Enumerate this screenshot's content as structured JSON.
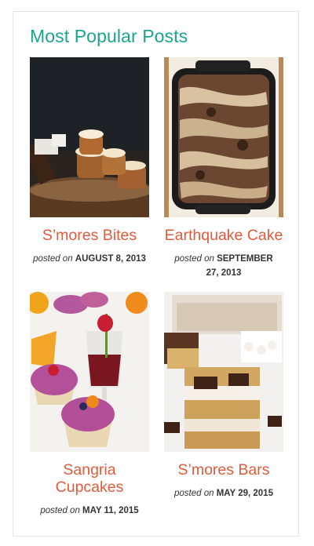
{
  "widget": {
    "title": "Most Popular Posts",
    "posted_label": "posted on",
    "posts": [
      {
        "title": "S’mores Bites",
        "date": "AUGUST 8, 2013",
        "image_icon": "smores-bites-photo"
      },
      {
        "title": "Earthquake Cake",
        "date": "SEPTEMBER 27, 2013",
        "image_icon": "earthquake-cake-photo"
      },
      {
        "title": "Sangria Cupcakes",
        "date": "MAY 11, 2015",
        "image_icon": "sangria-cupcakes-photo"
      },
      {
        "title": "S’mores Bars",
        "date": "MAY 29, 2015",
        "image_icon": "smores-bars-photo"
      }
    ]
  },
  "colors": {
    "title": "#1aa58c",
    "post_title": "#e25a3c",
    "border": "#e6e6e6"
  }
}
